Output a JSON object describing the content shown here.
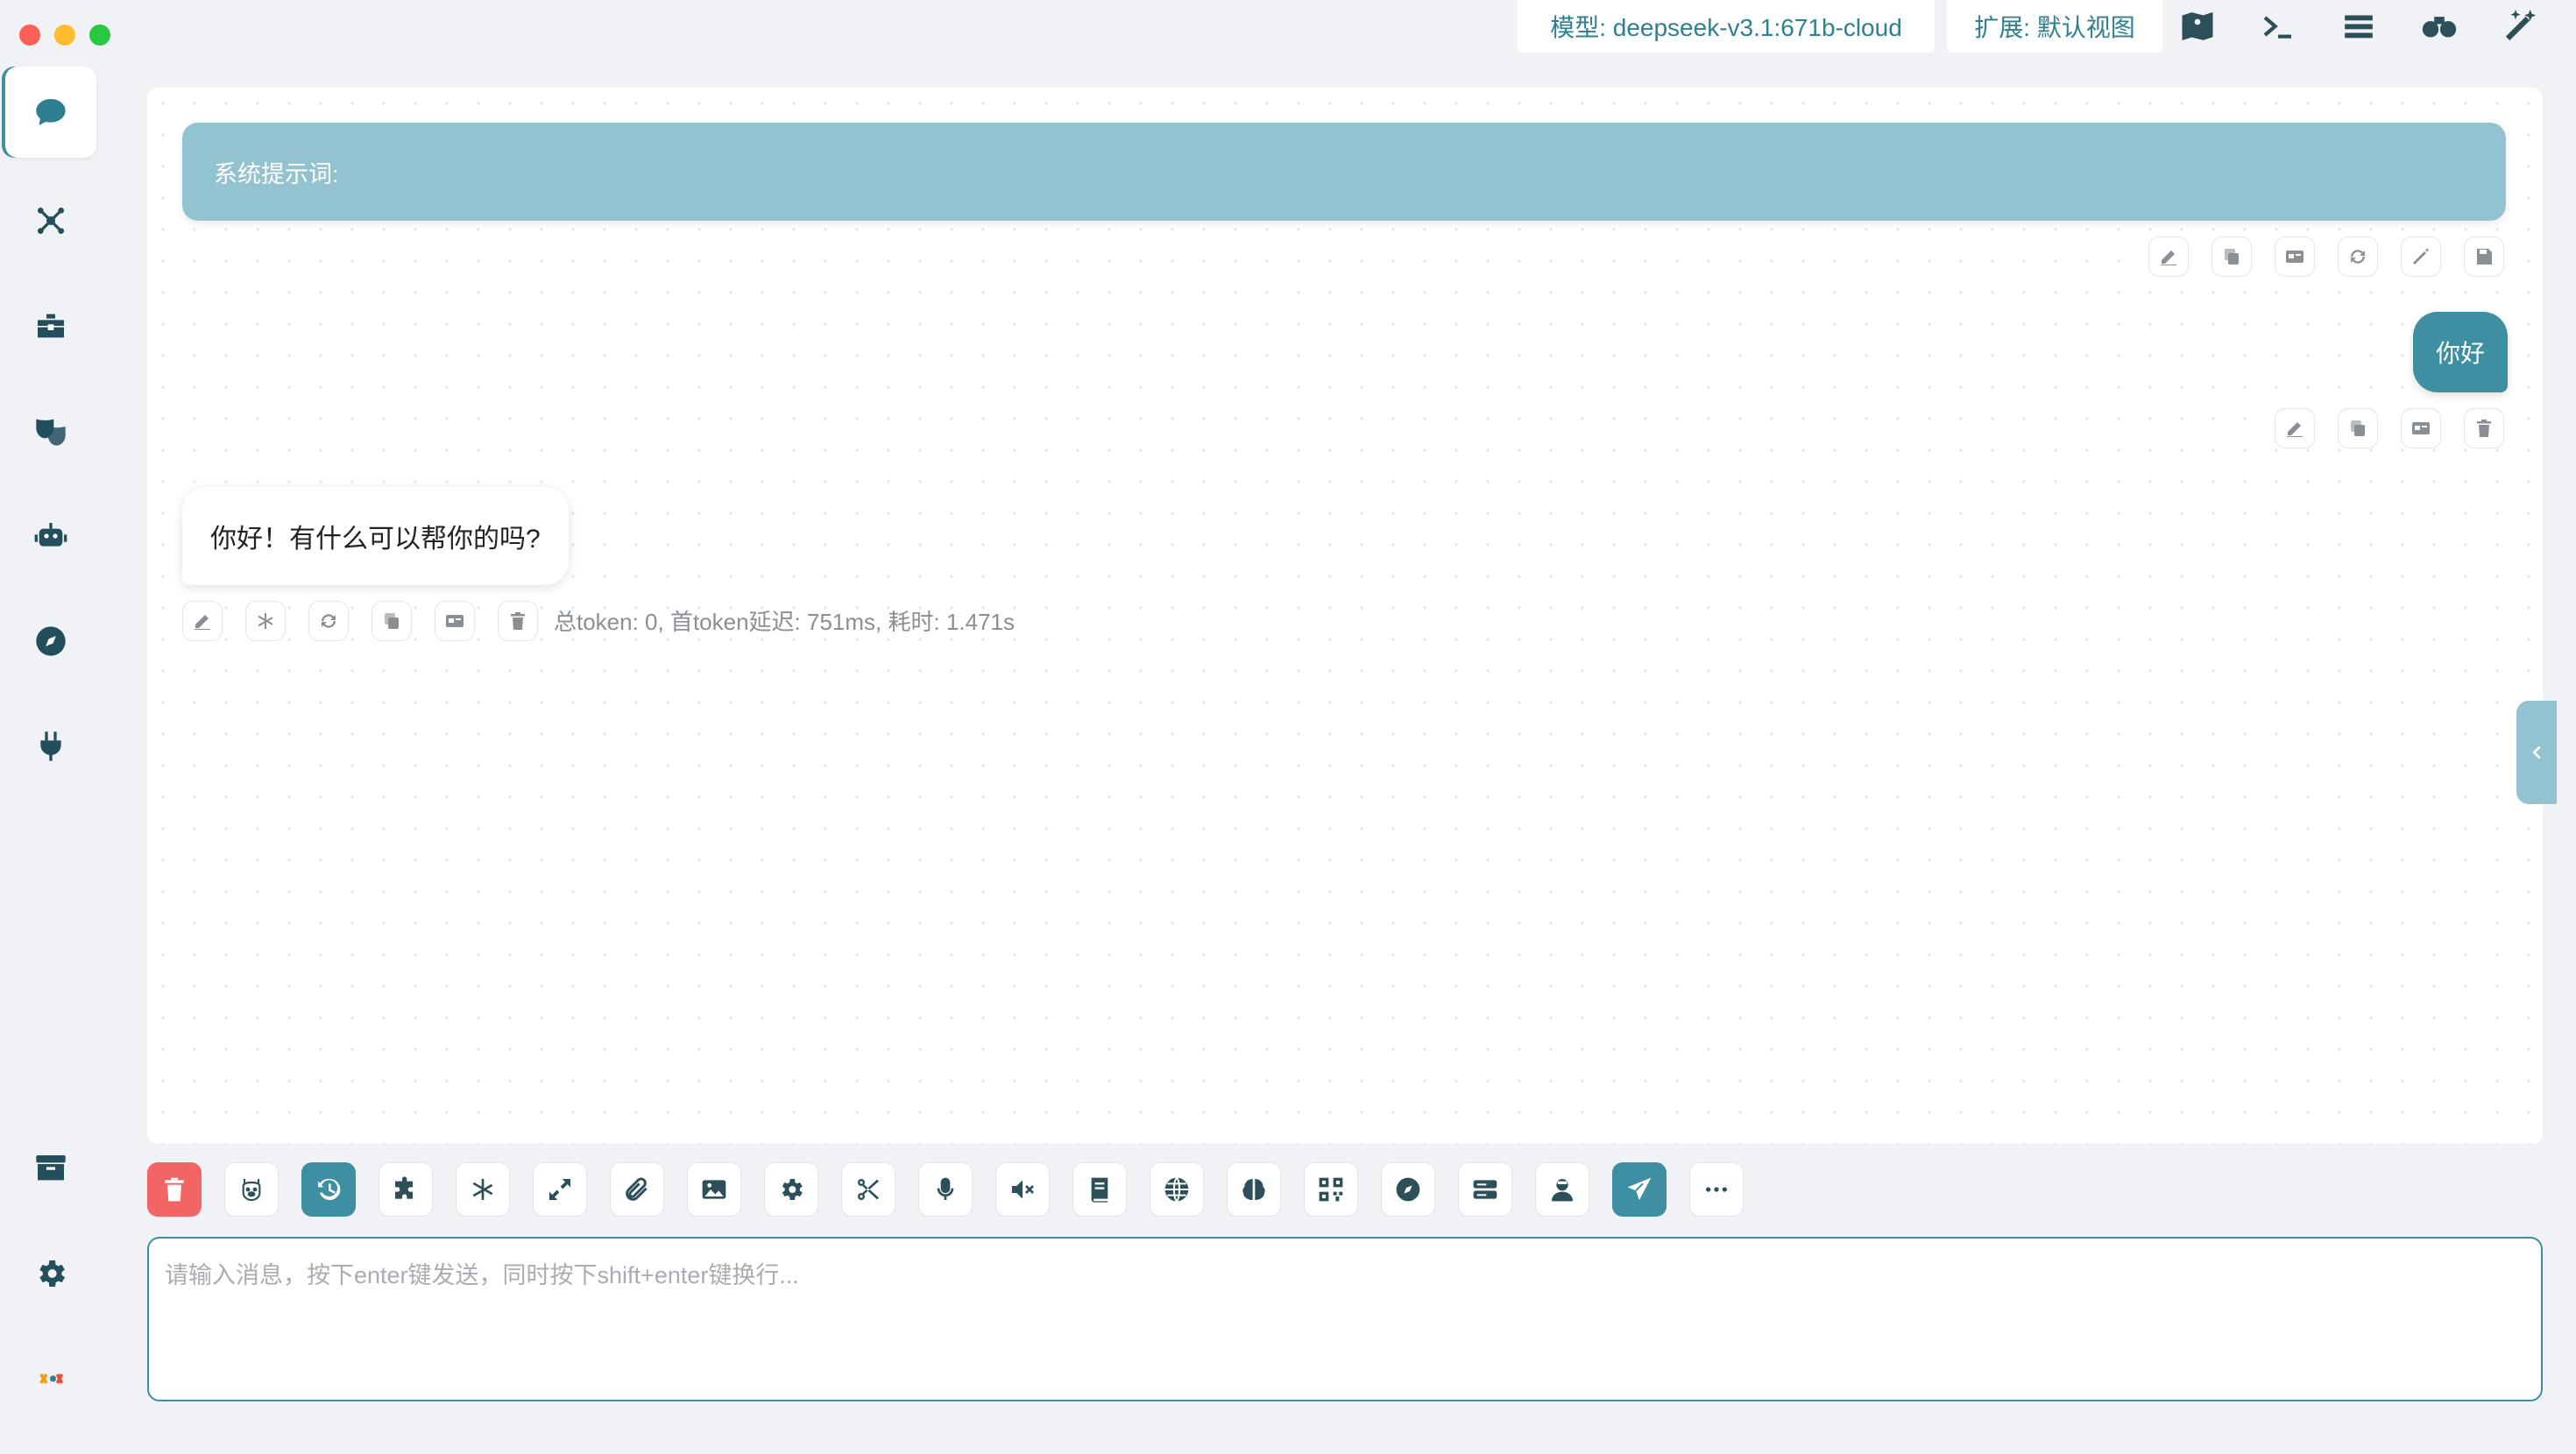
{
  "topbar": {
    "model_label": "模型: deepseek-v3.1:671b-cloud",
    "extension_label": "扩展: 默认视图"
  },
  "system_prompt": {
    "label": "系统提示词:"
  },
  "messages": {
    "user": "你好",
    "assistant": "你好！有什么可以帮你的吗?",
    "stats": "总token: 0, 首token延迟: 751ms, 耗时: 1.471s"
  },
  "input": {
    "placeholder": "请输入消息，按下enter键发送，同时按下shift+enter键换行..."
  },
  "sidebar": {
    "items": [
      "chat-icon",
      "network-icon",
      "toolbox-icon",
      "masks-icon",
      "robot-icon",
      "compass-icon",
      "plug-icon"
    ],
    "bottom": [
      "archive-icon",
      "gear-icon",
      "app-logo"
    ]
  },
  "toolbar_icons": [
    "trash-icon",
    "llama-icon",
    "history-icon",
    "puzzle-icon",
    "asterisk-icon",
    "expand-icon",
    "paperclip-icon",
    "image-icon",
    "settings-icon",
    "scissors-icon",
    "microphone-icon",
    "mute-icon",
    "book-icon",
    "globe-icon",
    "brain-icon",
    "qr-icon",
    "compass-icon",
    "server-icon",
    "user-icon",
    "send-icon",
    "more-icon"
  ],
  "colors": {
    "accent": "#3d8fa1",
    "system_prompt_bg": "#93c3d0",
    "delete_button": "#f36464",
    "background": "#f0f2f5"
  }
}
